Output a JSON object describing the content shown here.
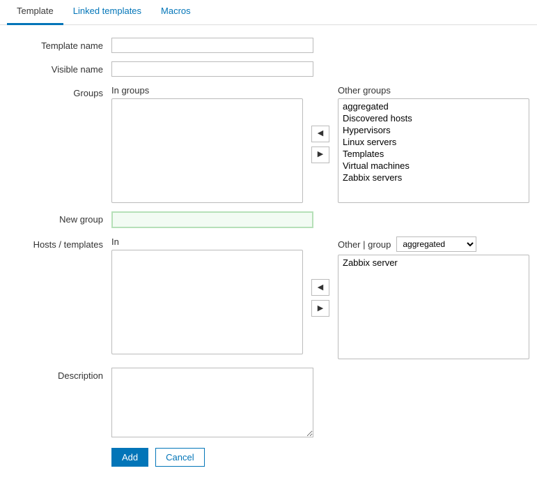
{
  "tabs": {
    "template": "Template",
    "linked": "Linked templates",
    "macros": "Macros"
  },
  "labels": {
    "template_name": "Template name",
    "visible_name": "Visible name",
    "groups": "Groups",
    "in_groups": "In groups",
    "other_groups": "Other groups",
    "new_group": "New group",
    "hosts_templates": "Hosts / templates",
    "in": "In",
    "other_group": "Other | group",
    "description": "Description"
  },
  "fields": {
    "template_name": "",
    "visible_name": "",
    "new_group": "",
    "description": ""
  },
  "groups": {
    "in": [],
    "other": [
      "aggregated",
      "Discovered hosts",
      "Hypervisors",
      "Linux servers",
      "Templates",
      "Virtual machines",
      "Zabbix servers"
    ]
  },
  "hosts": {
    "in": [],
    "filter_selected": "aggregated",
    "filter_options": [
      "aggregated"
    ],
    "other": [
      "Zabbix server"
    ]
  },
  "buttons": {
    "add": "Add",
    "cancel": "Cancel"
  }
}
